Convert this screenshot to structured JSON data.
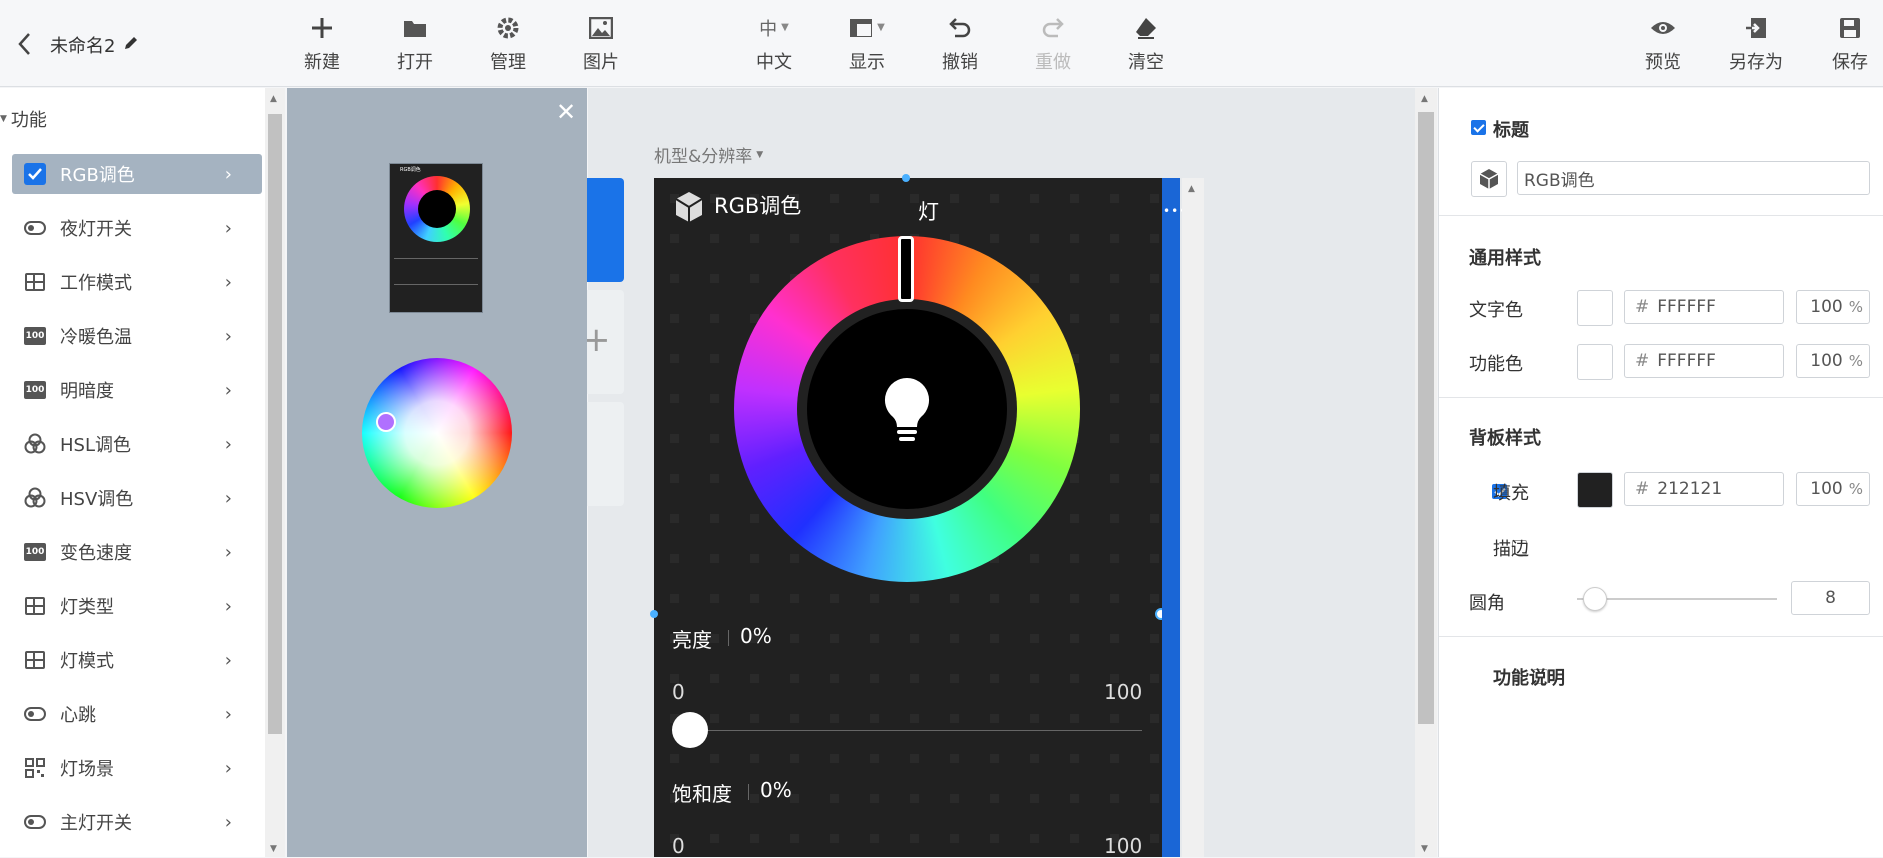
{
  "header": {
    "back_icon": "chevron-left-icon",
    "title": "未命名2",
    "edit_icon": "pencil-icon",
    "tools": [
      {
        "label": "新建",
        "icon": "plus-icon"
      },
      {
        "label": "打开",
        "icon": "folder-icon"
      },
      {
        "label": "管理",
        "icon": "gear-icon"
      },
      {
        "label": "图片",
        "icon": "image-icon"
      },
      {
        "label": "中文",
        "icon": "language-icon",
        "icon_text": "中"
      },
      {
        "label": "显示",
        "icon": "display-icon"
      },
      {
        "label": "撤销",
        "icon": "undo-icon"
      },
      {
        "label": "重做",
        "icon": "redo-icon",
        "disabled": true
      },
      {
        "label": "清空",
        "icon": "eraser-icon"
      }
    ],
    "right_tools": [
      {
        "label": "预览",
        "icon": "eye-icon"
      },
      {
        "label": "另存为",
        "icon": "save-as-icon"
      },
      {
        "label": "保存",
        "icon": "save-icon"
      }
    ]
  },
  "sidebar": {
    "section": "功能",
    "items": [
      {
        "label": "RGB调色",
        "icon": "checkbox-icon",
        "active": true
      },
      {
        "label": "夜灯开关",
        "icon": "toggle-icon"
      },
      {
        "label": "工作模式",
        "icon": "grid-icon"
      },
      {
        "label": "冷暖色温",
        "icon": "number-icon"
      },
      {
        "label": "明暗度",
        "icon": "number-icon"
      },
      {
        "label": "HSL调色",
        "icon": "color-circles-icon"
      },
      {
        "label": "HSV调色",
        "icon": "color-circles-icon"
      },
      {
        "label": "变色速度",
        "icon": "number-icon"
      },
      {
        "label": "灯类型",
        "icon": "grid-icon"
      },
      {
        "label": "灯模式",
        "icon": "grid-icon"
      },
      {
        "label": "心跳",
        "icon": "toggle-icon"
      },
      {
        "label": "灯场景",
        "icon": "qr-grid-icon"
      },
      {
        "label": "主灯开关",
        "icon": "toggle-icon"
      }
    ],
    "number_icon_text": "100"
  },
  "popup": {
    "close_icon": "close-icon",
    "thumb_title": "RGB调色"
  },
  "canvas": {
    "device_label": "机型&分辨率",
    "widget": {
      "title": "RGB调色",
      "top_label": "灯",
      "brightness_label": "亮度",
      "brightness_value": "0%",
      "brightness_min": "0",
      "brightness_max": "100",
      "saturation_label": "饱和度",
      "saturation_value": "0%",
      "saturation_min": "0",
      "saturation_max": "100"
    }
  },
  "properties": {
    "title_check_label": "标题",
    "title_value": "RGB调色",
    "general_style": "通用样式",
    "text_color_label": "文字色",
    "text_color_hex": "FFFFFF",
    "text_color_opacity": "100",
    "func_color_label": "功能色",
    "func_color_hex": "FFFFFF",
    "func_color_opacity": "100",
    "panel_style": "背板样式",
    "fill_label": "填充",
    "fill_hex": "212121",
    "fill_opacity": "100",
    "stroke_label": "描边",
    "radius_label": "圆角",
    "radius_value": "8",
    "func_desc_label": "功能说明",
    "hash": "#",
    "percent": "%"
  },
  "colors": {
    "accent": "#1a73e8",
    "sidebar_active": "#a5b3c1",
    "widget_bg": "#212121"
  }
}
